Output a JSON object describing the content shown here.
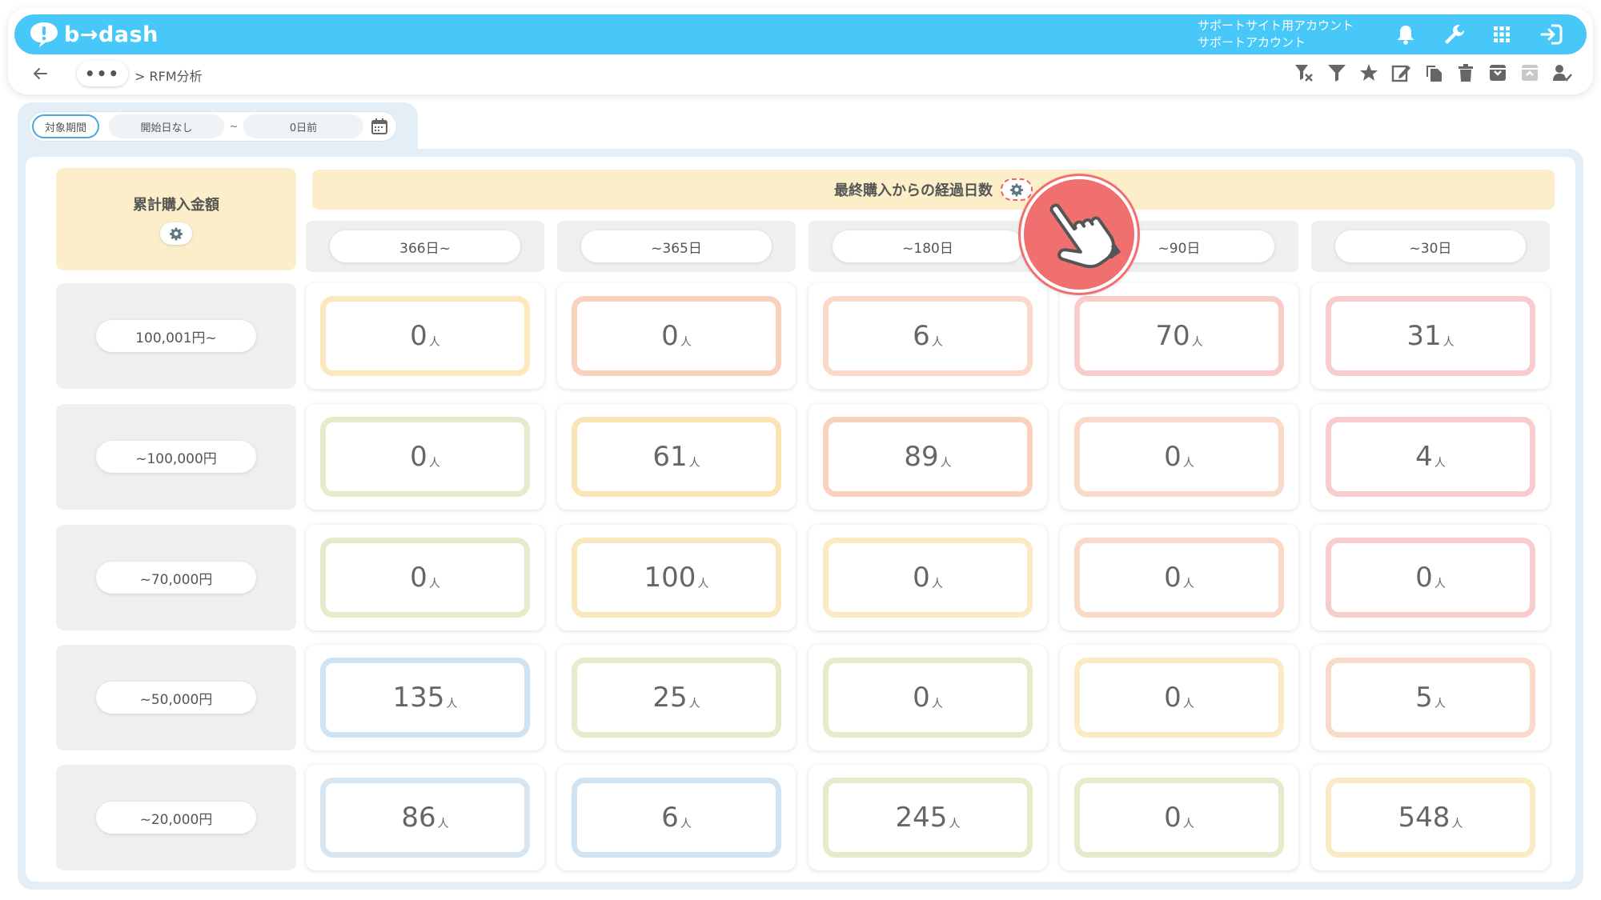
{
  "app": {
    "logo_text": "b→dash"
  },
  "account": {
    "line1": "サポートサイト用アカウント",
    "line2": "サポートアカウント"
  },
  "breadcrumb": {
    "ellipsis": "•••",
    "current": "> RFM分析"
  },
  "filter": {
    "label": "対象期間",
    "start": "開始日なし",
    "tilde": "~",
    "end": "0日前"
  },
  "matrix": {
    "row_header_title": "累計購入金額",
    "col_header_title": "最終購入からの経過日数",
    "unit": "人",
    "columns": [
      "366日~",
      "~365日",
      "~180日",
      "~90日",
      "~30日"
    ],
    "rows": [
      {
        "label": "100,001円~",
        "values": [
          "0",
          "0",
          "6",
          "70",
          "31"
        ]
      },
      {
        "label": "~100,000円",
        "values": [
          "0",
          "61",
          "89",
          "0",
          "4"
        ]
      },
      {
        "label": "~70,000円",
        "values": [
          "0",
          "100",
          "0",
          "0",
          "0"
        ]
      },
      {
        "label": "~50,000円",
        "values": [
          "135",
          "25",
          "0",
          "0",
          "5"
        ]
      },
      {
        "label": "~20,000円",
        "values": [
          "86",
          "6",
          "245",
          "0",
          "548"
        ]
      }
    ],
    "cell_colors": [
      [
        "#fbe9bd",
        "#f9d2bd",
        "#f9d9c8",
        "#f8ccc9",
        "#f8cccc"
      ],
      [
        "#e8eacb",
        "#fae4b4",
        "#f9d2bd",
        "#f9d9c8",
        "#f8cccc"
      ],
      [
        "#e8eacb",
        "#fae8bd",
        "#fbebc4",
        "#f9d9c8",
        "#f8cccc"
      ],
      [
        "#cfe3f3",
        "#e8eacb",
        "#e8eacb",
        "#fbebc4",
        "#f9d9c8"
      ],
      [
        "#d8e6f2",
        "#cfe3f3",
        "#e8eacb",
        "#e8eacb",
        "#fbebc4"
      ]
    ]
  },
  "colors": {
    "brand": "#48c8f8",
    "header_yellow": "#fbeec8",
    "pointer": "#f07070"
  }
}
